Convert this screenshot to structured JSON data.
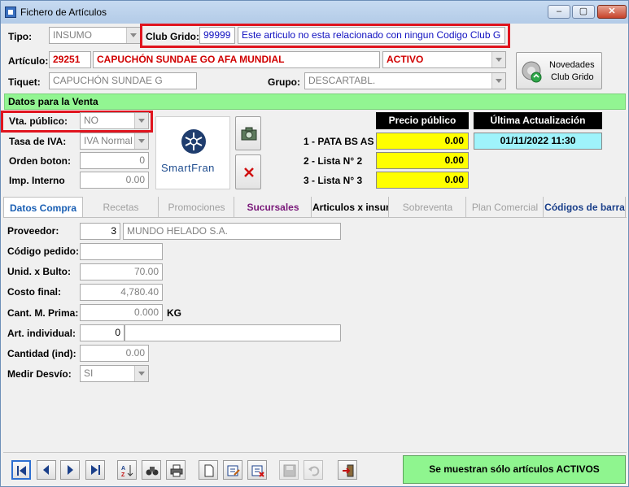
{
  "window": {
    "title": "Fichero de Artículos"
  },
  "header": {
    "tipo_label": "Tipo:",
    "tipo_value": "INSUMO",
    "club_label": "Club Grido:",
    "club_code": "99999",
    "club_message": "Este articulo no esta relacionado con ningun Codigo Club G",
    "articulo_label": "Artículo:",
    "articulo_code": "29251",
    "articulo_name": "CAPUCHÓN SUNDAE GO AFA MUNDIAL",
    "estado": "ACTIVO",
    "tiquet_label": "Tiquet:",
    "tiquet_value": "CAPUCHÓN SUNDAE G",
    "grupo_label": "Grupo:",
    "grupo_value": "DESCARTABL.",
    "novedades_line1": "Novedades",
    "novedades_line2": "Club Grido"
  },
  "venta": {
    "section_title": "Datos para la Venta",
    "vta_publico_label": "Vta. público:",
    "vta_publico_value": "NO",
    "tasa_iva_label": "Tasa de IVA:",
    "tasa_iva_value": "IVA Normal",
    "orden_boton_label": "Orden boton:",
    "orden_boton_value": "0",
    "imp_interno_label": "Imp. Interno",
    "imp_interno_value": "0.00",
    "logo_text": "SmartFran",
    "precio_header": "Precio público",
    "actualizacion_header": "Última Actualización",
    "actualizacion_value": "01/11/2022 11:30",
    "prices": [
      {
        "label": "1 - PATA BS AS :",
        "value": "0.00"
      },
      {
        "label": "2 - Lista N° 2",
        "value": "0.00"
      },
      {
        "label": "3 - Lista N° 3",
        "value": "0.00"
      }
    ]
  },
  "tabs": [
    {
      "label": "Datos Compra"
    },
    {
      "label": "Recetas"
    },
    {
      "label": "Promociones"
    },
    {
      "label": "Sucursales"
    },
    {
      "label": "Articulos x insumo"
    },
    {
      "label": "Sobreventa"
    },
    {
      "label": "Plan Comercial"
    },
    {
      "label": "Códigos de barra"
    }
  ],
  "compra": {
    "proveedor_label": "Proveedor:",
    "proveedor_code": "3",
    "proveedor_name": "MUNDO HELADO S.A.",
    "codigo_pedido_label": "Código pedido:",
    "codigo_pedido_value": "",
    "unid_bulto_label": "Unid. x Bulto:",
    "unid_bulto_value": "70.00",
    "costo_final_label": "Costo final:",
    "costo_final_value": "4,780.40",
    "cant_mprima_label": "Cant. M. Prima:",
    "cant_mprima_value": "0.000",
    "cant_mprima_unit": "KG",
    "art_individual_label": "Art. individual:",
    "art_individual_code": "0",
    "art_individual_name": "",
    "cantidad_ind_label": "Cantidad (ind):",
    "cantidad_ind_value": "0.00",
    "medir_desvio_label": "Medir Desvío:",
    "medir_desvio_value": "SI"
  },
  "footer": {
    "status_button": "Se muestran sólo artículos ACTIVOS"
  },
  "colors": {
    "highlight": "#e0141e",
    "green": "#92f592",
    "yellow": "#ffff00",
    "cyan": "#9ff3fb"
  }
}
